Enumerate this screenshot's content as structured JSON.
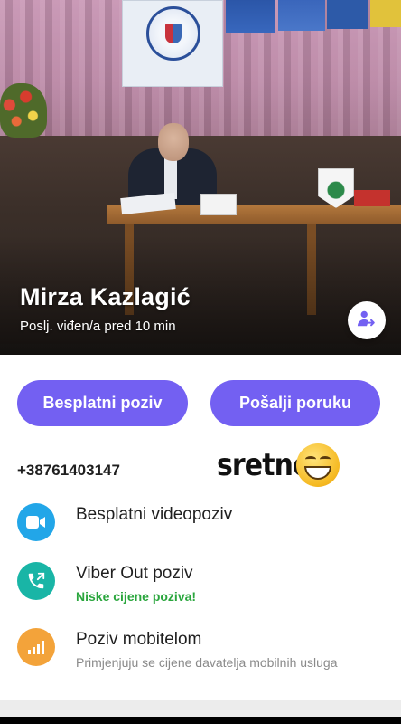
{
  "contact": {
    "name": "Mirza Kazlagić",
    "last_seen": "Poslj. viđen/a pred 10 min"
  },
  "actions": {
    "free_call_label": "Besplatni poziv",
    "send_message_label": "Pošalji poruku"
  },
  "phone_number": "+38761403147",
  "sticker": {
    "text": "sretno",
    "emoji": "grinning-face"
  },
  "options": [
    {
      "title": "Besplatni videopoziv",
      "subtitle": "",
      "icon": "video-camera-icon",
      "color": "#22a6e8"
    },
    {
      "title": "Viber Out poziv",
      "subtitle": "Niske cijene poziva!",
      "icon": "phone-out-icon",
      "color": "#19b5a6",
      "subtitle_color": "#2aa63d"
    },
    {
      "title": "Poziv mobitelom",
      "subtitle": "Primjenjuju se cijene davatelja mobilnih usluga",
      "icon": "signal-bars-icon",
      "color": "#f3a33a",
      "subtitle_color": "#8a8a8a"
    }
  ],
  "colors": {
    "accent": "#7360f2"
  }
}
